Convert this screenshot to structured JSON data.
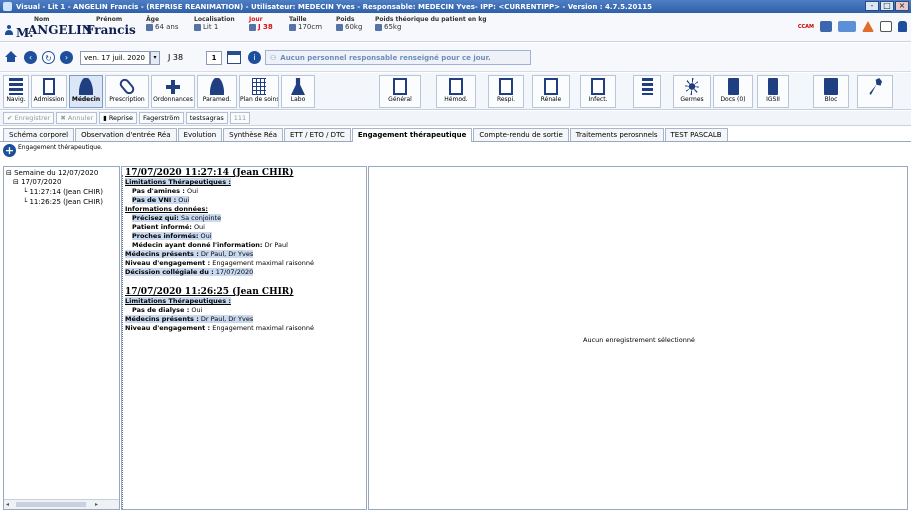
{
  "window": {
    "title": "Visual - Lit 1 - ANGELIN Francis - (REPRISE REANIMATION) - Utilisateur: MEDECIN Yves - Responsable: MEDECIN Yves- IPP: <CURRENTIPP> - Version : 4.7.5.20115",
    "buttons": [
      "-",
      "□",
      "×"
    ]
  },
  "patient": {
    "nom_label": "Nom",
    "nom_prefix": "M.",
    "nom": "ANGELIN",
    "prenom_label": "Prénom",
    "prenom": "Francis",
    "age_label": "Âge",
    "age": "64 ans",
    "localisation_label": "Localisation",
    "localisation": "Lit 1",
    "jour_label": "Jour",
    "jour": "J 38",
    "taille_label": "Taille",
    "taille": "170cm",
    "poids_label": "Poids",
    "poids": "60kg",
    "poids_theo_label": "Poids théorique du patient en kg",
    "poids_theo": "65kg",
    "ccam": "CCAM"
  },
  "nav": {
    "date": "ven. 17 juil. 2020",
    "day_label": "J 38",
    "day_num": "1",
    "responsable_msg": "Aucun personnel responsable renseigné pour ce jour."
  },
  "toolbar": {
    "modules": [
      {
        "label": "Navig.",
        "icon": "navigation-icon"
      },
      {
        "label": "Admission",
        "icon": "admission-icon"
      },
      {
        "label": "Médecin",
        "icon": "doctor-icon"
      },
      {
        "label": "Prescription",
        "icon": "pill-icon"
      },
      {
        "label": "Ordonnances",
        "icon": "medical-cross-icon"
      },
      {
        "label": "Paramed.",
        "icon": "nurse-icon"
      },
      {
        "label": "Plan de soins",
        "icon": "care-plan-grid-icon"
      },
      {
        "label": "Labo",
        "icon": "flask-icon"
      },
      {
        "label": "Général",
        "icon": "chart-icon"
      },
      {
        "label": "Hémod.",
        "icon": "chart-icon"
      },
      {
        "label": "Respi.",
        "icon": "chart-icon"
      },
      {
        "label": "Rénale",
        "icon": "chart-icon"
      },
      {
        "label": "Infect.",
        "icon": "chart-icon"
      },
      {
        "label": "",
        "icon": "list-icon"
      },
      {
        "label": "Germes",
        "icon": "germ-icon"
      },
      {
        "label": "Docs (0)",
        "icon": "documents-icon"
      },
      {
        "label": "IGSII",
        "icon": "score-document-icon"
      },
      {
        "label": "Bloc",
        "icon": "bloc-icon"
      },
      {
        "label": "",
        "icon": "wrench-icon"
      }
    ]
  },
  "actions": {
    "enregistrer": "Enregistrer",
    "annuler": "Annuler",
    "reprise": "Reprise",
    "fagerstrom": "Fagerström",
    "testsagras": "testsagras",
    "n111": "111"
  },
  "tabs": [
    "Schéma corporel",
    "Observation d'entrée Réa",
    "Evolution",
    "Synthèse Réa",
    "ETT / ETO / DTC",
    "Engagement thérapeutique",
    "Compte-rendu de sortie",
    "Traitements perosnnels",
    "TEST PASCALB"
  ],
  "subhead": {
    "label": "Engagement thérapeutique."
  },
  "tree": {
    "week": "Semaine du 12/07/2020",
    "day": "17/07/2020",
    "entries": [
      "11:27:14 (Jean CHIR)",
      "11:26:25 (Jean CHIR)"
    ]
  },
  "records": {
    "r1": {
      "title": "17/07/2020 11:27:14 (Jean CHIR)",
      "limitations": "Limitations Thérapeutiques :",
      "amines_label": "Pas d'amines :",
      "amines_val": "Oui",
      "vni_label": "Pas de VNI :",
      "vni_val": "Oui",
      "infos": "Informations données:",
      "precisez_label": "Précisez qui:",
      "precisez_val": "Sa conjointe",
      "patient_label": "Patient informé:",
      "patient_val": "Oui",
      "proches_label": "Proches informés:",
      "proches_val": "Oui",
      "medecin_info_label": "Médecin ayant donné l'information:",
      "medecin_info_val": "Dr Paul",
      "presents_label": "Médecins présents :",
      "presents_val": "Dr Paul, Dr Yves",
      "niveau_label": "Niveau d'engagement :",
      "niveau_val": "Engagement maximal raisonné",
      "decision_label": "Décission collégiale du :",
      "decision_val": "17/07/2020"
    },
    "r2": {
      "title": "17/07/2020 11:26:25 (Jean CHIR)",
      "limitations": "Limitations Thérapeutiques :",
      "dialyse_label": "Pas de dialyse :",
      "dialyse_val": "Oui",
      "presents_label": "Médecins présents :",
      "presents_val": "Dr Paul, Dr Yves",
      "niveau_label": "Niveau d'engagement :",
      "niveau_val": "Engagement maximal raisonné"
    }
  },
  "detail": {
    "empty_msg": "Aucun enregistrement sélectionné"
  }
}
